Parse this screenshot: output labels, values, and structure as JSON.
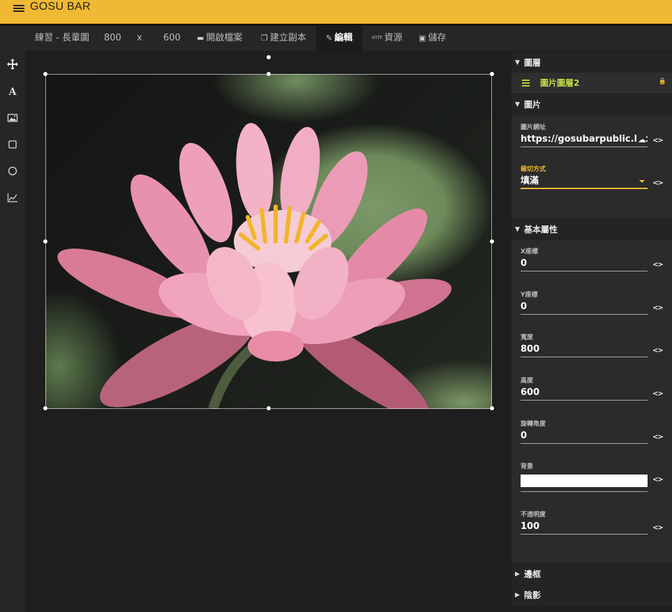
{
  "app": {
    "title": "GOSU BAR"
  },
  "toolbar": {
    "project_name": "練習 - 長輩圖",
    "width": "800",
    "times": "x",
    "height": "600",
    "open_label": "開啟檔案",
    "copy_label": "建立副本",
    "edit_label": "編輯",
    "http_badge": "HTTP",
    "resources_label": "資源",
    "save_label": "儲存"
  },
  "tools": [
    "move-tool",
    "text-tool",
    "image-tool",
    "rectangle-tool",
    "circle-tool",
    "chart-tool"
  ],
  "panel": {
    "layers": {
      "title": "圖層",
      "selected_layer": "圖片圖層2"
    },
    "image": {
      "title": "圖片",
      "url_label": "圖片網址",
      "url_value": "https://gosubarpublic.blob.",
      "fit_label": "裁切方式",
      "fit_value": "填滿"
    },
    "basic": {
      "title": "基本屬性",
      "x_label": "X座標",
      "x_value": "0",
      "y_label": "Y座標",
      "y_value": "0",
      "w_label": "寬度",
      "w_value": "800",
      "h_label": "高度",
      "h_value": "600",
      "rot_label": "旋轉角度",
      "rot_value": "0",
      "bg_label": "背景",
      "bg_color": "#ffffff",
      "opacity_label": "不透明度",
      "opacity_value": "100"
    },
    "border": {
      "title": "邊框"
    },
    "shadow": {
      "title": "陰影"
    }
  },
  "colors": {
    "accent": "#f0b933",
    "layer_highlight": "#c2d94a"
  }
}
